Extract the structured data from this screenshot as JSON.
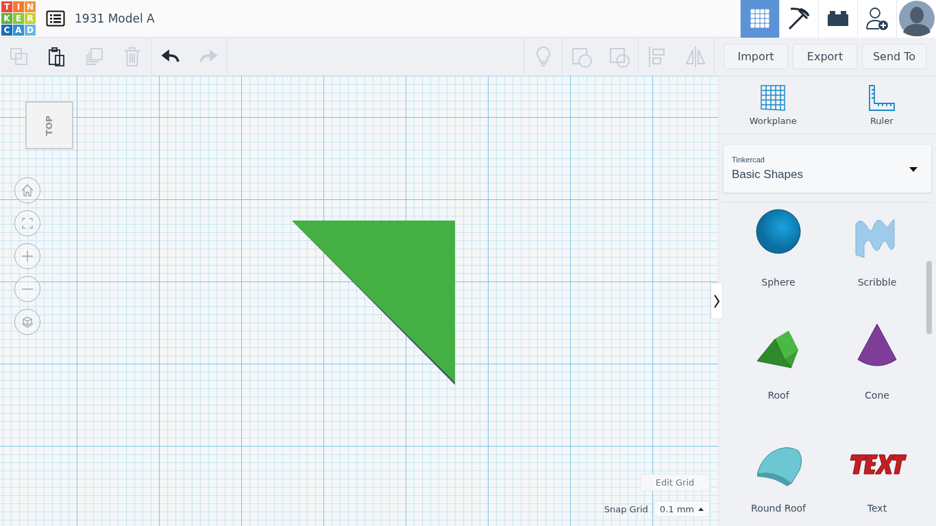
{
  "header": {
    "logo": [
      {
        "letter": "T",
        "color": "#e94b35"
      },
      {
        "letter": "I",
        "color": "#f37a2b"
      },
      {
        "letter": "N",
        "color": "#f7923a"
      },
      {
        "letter": "K",
        "color": "#5ab445"
      },
      {
        "letter": "E",
        "color": "#8cc63e"
      },
      {
        "letter": "R",
        "color": "#c3d52f"
      },
      {
        "letter": "C",
        "color": "#1b6db5"
      },
      {
        "letter": "A",
        "color": "#2f8fd2"
      },
      {
        "letter": "D",
        "color": "#6cb6e2"
      }
    ],
    "title": "1931 Model A",
    "view_tabs": [
      {
        "kind": "grid",
        "selected": true
      },
      {
        "kind": "pickaxe",
        "selected": false
      },
      {
        "kind": "brick",
        "selected": false
      },
      {
        "kind": "add-user",
        "selected": false
      }
    ]
  },
  "toolbar": {
    "left_groups": [
      [
        {
          "kind": "copy",
          "disabled": true
        },
        {
          "kind": "paste",
          "disabled": false
        },
        {
          "kind": "duplicate",
          "disabled": true
        },
        {
          "kind": "delete",
          "disabled": true
        }
      ],
      [
        {
          "kind": "undo",
          "disabled": false
        },
        {
          "kind": "redo",
          "disabled": true
        }
      ]
    ],
    "right_groups": [
      [
        {
          "kind": "bulb",
          "disabled": true
        }
      ],
      [
        {
          "kind": "group",
          "disabled": true
        },
        {
          "kind": "hole",
          "disabled": true
        }
      ],
      [
        {
          "kind": "align",
          "disabled": true
        },
        {
          "kind": "mirror",
          "disabled": true
        }
      ]
    ],
    "buttons": [
      "Import",
      "Export",
      "Send To"
    ]
  },
  "canvas": {
    "view_cube": "TOP",
    "nav": [
      {
        "kind": "home"
      },
      {
        "kind": "fit"
      },
      {
        "kind": "zoom-in"
      },
      {
        "kind": "zoom-out"
      },
      {
        "kind": "perspective"
      }
    ],
    "edit_grid": "Edit Grid",
    "snap_label": "Snap Grid",
    "snap_value": "0.1 mm"
  },
  "sidebar": {
    "tools": [
      {
        "kind": "workplane",
        "label": "Workplane"
      },
      {
        "kind": "ruler",
        "label": "Ruler"
      }
    ],
    "library": {
      "source": "Tinkercad",
      "value": "Basic Shapes"
    },
    "shapes": [
      {
        "kind": "sphere",
        "label": "Sphere"
      },
      {
        "kind": "scribble",
        "label": "Scribble"
      },
      {
        "kind": "roof",
        "label": "Roof"
      },
      {
        "kind": "cone",
        "label": "Cone"
      },
      {
        "kind": "round-roof",
        "label": "Round Roof"
      },
      {
        "kind": "text",
        "label": "Text"
      }
    ]
  }
}
